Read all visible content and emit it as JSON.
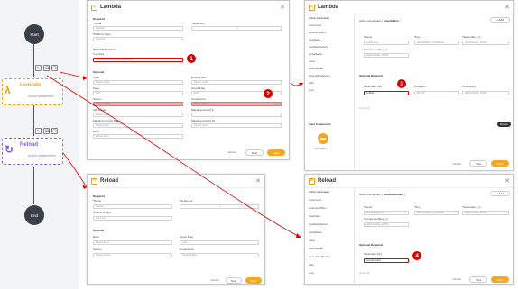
{
  "colors": {
    "accent": "#f5a623",
    "lambda": "#f0a000",
    "reload": "#8a5bd6",
    "highlight": "#e00000"
  },
  "flow": {
    "start": "Start",
    "end": "End",
    "lambda": {
      "title": "Lambda",
      "sub": "Action parameter"
    },
    "reload": {
      "title": "Reload",
      "sub": "Action parameters"
    },
    "toolbar_icons": [
      "edit-icon",
      "delete-icon",
      "copy-icon"
    ]
  },
  "dlg1": {
    "title": "Lambda",
    "required": "Required",
    "name_label": "*Name",
    "name_value": "Lambda",
    "seq_label": "*Sequence",
    "seq_value": "1",
    "platform_label": "*Platform Type",
    "platform_value": "Common",
    "optreq": "Optional Required",
    "lambda_label": "*Lambda",
    "lambda_value": "selectLambda(xxx#lambdaName)",
    "optional": "Optional",
    "type_label": "Type",
    "type_ph": "Please select",
    "binding_label": "Binding Item",
    "binding_ph": "Please select",
    "page_label": "Page",
    "page_value": "Null",
    "async_label": "Async Flag",
    "async_value": "Null",
    "screen_label": "Screen",
    "screen_ph": "Please Select",
    "component_label": "Component",
    "component_ph": "Please Select",
    "tabscreen_label": "Tab Screen",
    "tabscreen_ph": "Please Input",
    "mapping_label": "Mapping Control #",
    "mapcontrol_label": "Mapping Control Name",
    "mapcontrol_ph": "Please Input",
    "mapcontrolid_label": "Mapping Control ID",
    "mapcontrolid_ph": "Please Input",
    "desc_label": "Desc",
    "desc_ph": "Please input",
    "cancel": "Cancel",
    "next": "Next",
    "save": "Save"
  },
  "dlg2": {
    "title": "Reload",
    "required": "Required",
    "name_label": "*Name",
    "name_value": "Reload",
    "seq_label": "*Sequence",
    "seq_value": "2",
    "platform_label": "*Platform Type",
    "platform_value": "Common",
    "optional": "Optional",
    "desc_label": "Desc",
    "desc_ph": "Please input",
    "async_label": "Async Flag",
    "async_value": "Null",
    "screen_label": "Screen",
    "screen_ph": "Please Select",
    "component_label": "Component",
    "component_ph": "Please Select",
    "cancel": "Cancel",
    "next": "Next",
    "save": "Save"
  },
  "dlg3": {
    "title": "Lambda",
    "side": [
      "Action parameter",
      "customList",
      "selectionIdBox",
      "fixedData",
      "fixedDataSelect",
      "globalMeta",
      "meta",
      "paramMeta",
      "paramMetaSelect",
      "path",
      "prop"
    ],
    "header_prefix": "Action component ( ",
    "header_name": "selectIdBox",
    "header_suffix": " )",
    "add": "+ Add",
    "col_name": "*Name",
    "col_key": "*Key",
    "col_screen": "*Screen(key_x)",
    "row_name": "selectIdbox",
    "row_key": "0f6f74a4a1f7-1cad8b66a",
    "row_screen": "aQjSchedule_20003",
    "comp_label": "*Component(key_x)",
    "comp_value": "aQjSchedule_20003",
    "optreq": "Optional Required",
    "pk_label": "Parameter Key",
    "cond_label": "Condition",
    "comp2_label": "Component",
    "pk_value": "sysDts",
    "cond_value": "5/5_10",
    "comp2_value": "aQjSchedule_20003",
    "optional": "Optional",
    "save_comp": "Save Component",
    "delete": "Delete",
    "file_label": "selectIdbox",
    "cancel": "Cancel",
    "prev": "Prev",
    "save": "Save"
  },
  "dlg4": {
    "title": "Reload",
    "side": [
      "Action parameter",
      "customList",
      "selectionIdBox",
      "fixedData",
      "fixedDataSelect",
      "globalMeta",
      "meta",
      "paramMeta",
      "paramMetaSelect",
      "path",
      "prop"
    ],
    "header_prefix": "Action component ( ",
    "header_name": "fixedDataSelect",
    "header_suffix": " )",
    "add": "+ Add",
    "col_name": "*Name",
    "col_key": "*Key",
    "col_screen": "*Screen(key_x)",
    "row_name": "fixedDataSelect",
    "row_key": "0f6f74a4a1f7-1cad8b66a",
    "row_screen": "aQjSchedule_20003",
    "comp_label": "*Component(key_x)",
    "comp_value": "aQjSchedule_20003",
    "optreq": "Optional Required",
    "pk_label": "Parameter Key",
    "pk_value": "componentId",
    "optional": "Optional",
    "cancel": "Cancel",
    "prev": "Prev",
    "save": "Save"
  },
  "badges": [
    "1",
    "2",
    "3",
    "4"
  ]
}
